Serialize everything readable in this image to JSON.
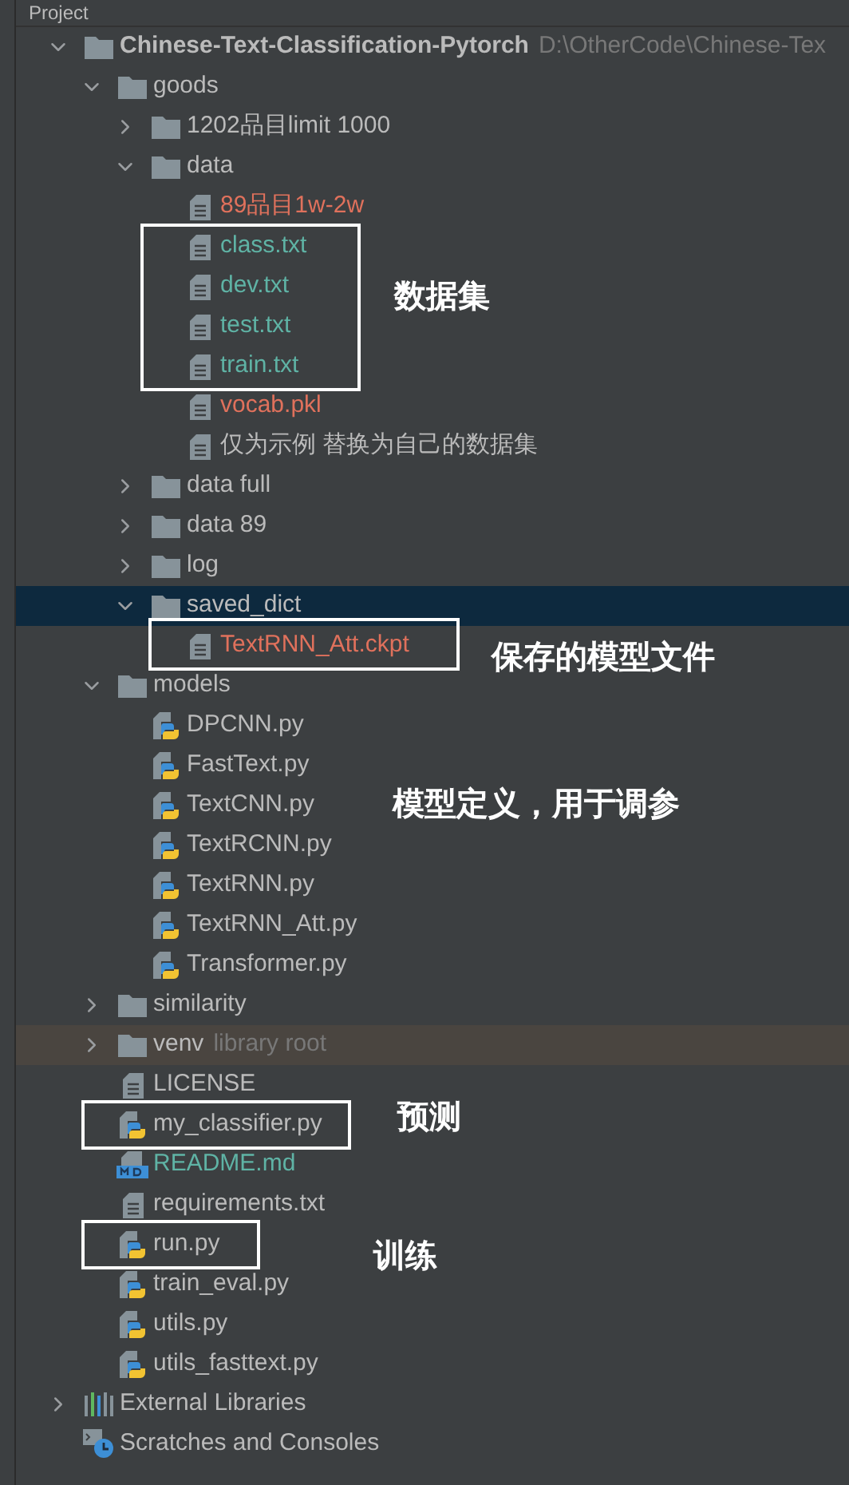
{
  "header": {
    "title": "Project"
  },
  "tree": [
    {
      "name": "Chinese-Text-Classification-Pytorch",
      "kind": "folder",
      "expanded": true,
      "selected": false,
      "bold": true,
      "color": "#bbbbbb",
      "note": "D:\\OtherCode\\Chinese-Tex",
      "children": [
        {
          "name": "goods",
          "kind": "folder",
          "expanded": true,
          "selected": false,
          "color": "#bbbbbb",
          "children": [
            {
              "name": "1202品目limit 1000",
              "kind": "folder",
              "expanded": false,
              "selected": false,
              "color": "#bbbbbb"
            },
            {
              "name": "data",
              "kind": "folder",
              "expanded": true,
              "selected": false,
              "color": "#bbbbbb",
              "children": [
                {
                  "name": "89品目1w-2w",
                  "kind": "file",
                  "selected": false,
                  "color": "#e0715c"
                },
                {
                  "name": "class.txt",
                  "kind": "file",
                  "selected": false,
                  "color": "#5fb3a5"
                },
                {
                  "name": "dev.txt",
                  "kind": "file",
                  "selected": false,
                  "color": "#5fb3a5"
                },
                {
                  "name": "test.txt",
                  "kind": "file",
                  "selected": false,
                  "color": "#5fb3a5"
                },
                {
                  "name": "train.txt",
                  "kind": "file",
                  "selected": false,
                  "color": "#5fb3a5"
                },
                {
                  "name": "vocab.pkl",
                  "kind": "file",
                  "selected": false,
                  "color": "#e0715c"
                },
                {
                  "name": "仅为示例 替换为自己的数据集",
                  "kind": "file",
                  "selected": false,
                  "color": "#bbbbbb"
                }
              ]
            },
            {
              "name": "data full",
              "kind": "folder",
              "expanded": false,
              "selected": false,
              "color": "#bbbbbb"
            },
            {
              "name": "data 89",
              "kind": "folder",
              "expanded": false,
              "selected": false,
              "color": "#bbbbbb"
            },
            {
              "name": "log",
              "kind": "folder",
              "expanded": false,
              "selected": false,
              "color": "#bbbbbb"
            },
            {
              "name": "saved_dict",
              "kind": "folder",
              "expanded": true,
              "selected": true,
              "color": "#bbbbbb",
              "children": [
                {
                  "name": "TextRNN_Att.ckpt",
                  "kind": "file",
                  "selected": false,
                  "color": "#e0715c"
                }
              ]
            }
          ]
        },
        {
          "name": "models",
          "kind": "folder",
          "expanded": true,
          "selected": false,
          "color": "#bbbbbb",
          "children": [
            {
              "name": "DPCNN.py",
              "kind": "python",
              "selected": false,
              "color": "#bbbbbb"
            },
            {
              "name": "FastText.py",
              "kind": "python",
              "selected": false,
              "color": "#bbbbbb"
            },
            {
              "name": "TextCNN.py",
              "kind": "python",
              "selected": false,
              "color": "#bbbbbb"
            },
            {
              "name": "TextRCNN.py",
              "kind": "python",
              "selected": false,
              "color": "#bbbbbb"
            },
            {
              "name": "TextRNN.py",
              "kind": "python",
              "selected": false,
              "color": "#bbbbbb"
            },
            {
              "name": "TextRNN_Att.py",
              "kind": "python",
              "selected": false,
              "color": "#bbbbbb"
            },
            {
              "name": "Transformer.py",
              "kind": "python",
              "selected": false,
              "color": "#bbbbbb"
            }
          ]
        },
        {
          "name": "similarity",
          "kind": "folder",
          "expanded": false,
          "selected": false,
          "color": "#bbbbbb"
        },
        {
          "name": "venv",
          "kind": "folder",
          "expanded": false,
          "selected": false,
          "excluded": true,
          "color": "#bbbbbb",
          "note": "library root"
        },
        {
          "name": "LICENSE",
          "kind": "file",
          "selected": false,
          "color": "#bbbbbb"
        },
        {
          "name": "my_classifier.py",
          "kind": "python",
          "selected": false,
          "color": "#bbbbbb"
        },
        {
          "name": "README.md",
          "kind": "markdown",
          "selected": false,
          "color": "#5fb3a5"
        },
        {
          "name": "requirements.txt",
          "kind": "file",
          "selected": false,
          "color": "#bbbbbb"
        },
        {
          "name": "run.py",
          "kind": "python",
          "selected": false,
          "color": "#bbbbbb"
        },
        {
          "name": "train_eval.py",
          "kind": "python",
          "selected": false,
          "color": "#bbbbbb"
        },
        {
          "name": "utils.py",
          "kind": "python",
          "selected": false,
          "color": "#bbbbbb"
        },
        {
          "name": "utils_fasttext.py",
          "kind": "python",
          "selected": false,
          "color": "#bbbbbb"
        }
      ]
    },
    {
      "name": "External Libraries",
      "kind": "library",
      "expanded": false,
      "selected": false,
      "color": "#bbbbbb"
    },
    {
      "name": "Scratches and Consoles",
      "kind": "scratches",
      "selected": false,
      "color": "#bbbbbb"
    }
  ],
  "annotations": [
    {
      "label": "数据集"
    },
    {
      "label": "保存的模型文件"
    },
    {
      "label": "模型定义，用于调参"
    },
    {
      "label": "预测"
    },
    {
      "label": "训练"
    }
  ]
}
